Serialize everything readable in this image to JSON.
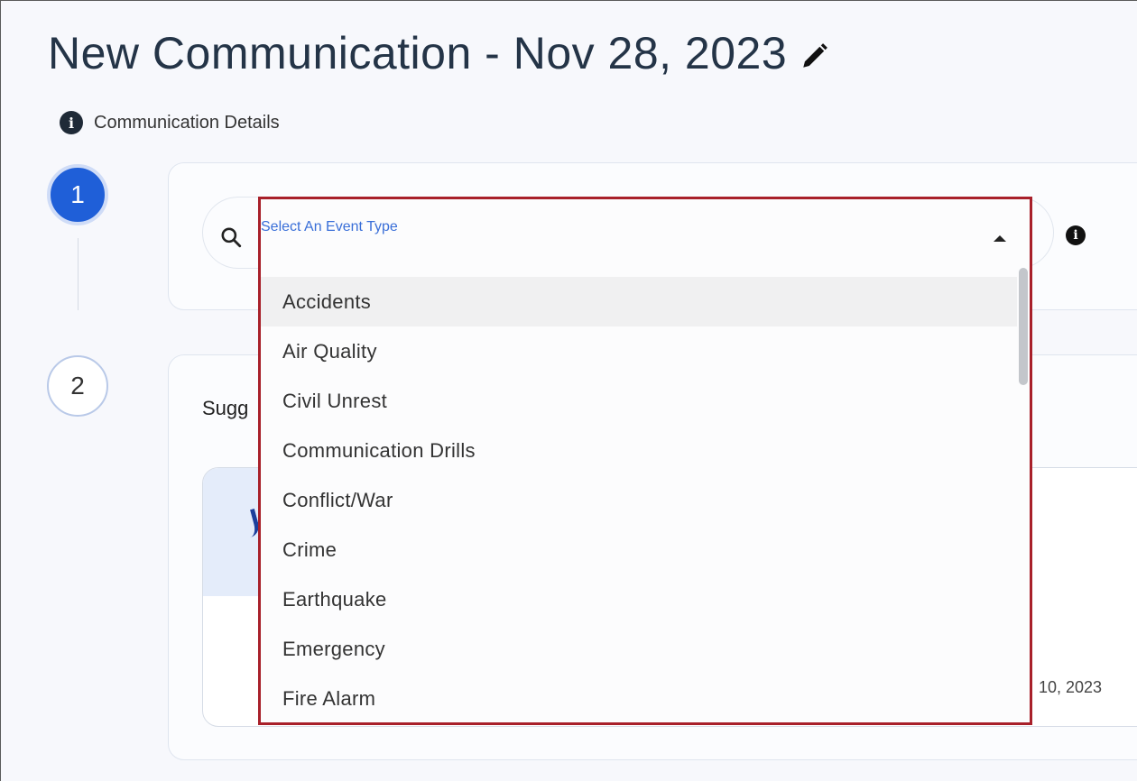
{
  "header": {
    "title": "New Communication - Nov 28, 2023",
    "edit_icon": "pencil-icon"
  },
  "details": {
    "label": "Communication Details",
    "icon": "info-icon"
  },
  "steps": [
    {
      "number": "1",
      "active": true
    },
    {
      "number": "2",
      "active": false
    }
  ],
  "event_select": {
    "placeholder": "Select An Event Type",
    "icon": "search-icon",
    "caret_icon": "caret-up-icon",
    "options": [
      "Accidents",
      "Air Quality",
      "Civil Unrest",
      "Communication Drills",
      "Conflict/War",
      "Crime",
      "Earthquake",
      "Emergency",
      "Fire Alarm"
    ],
    "highlighted": "Accidents"
  },
  "suggestions": {
    "label_visible": "Sugg",
    "card_date_fragment": "10, 2023"
  },
  "colors": {
    "accent": "#1f5fd8",
    "dropdown_border": "#a8202a",
    "placeholder": "#3a6fd8"
  }
}
